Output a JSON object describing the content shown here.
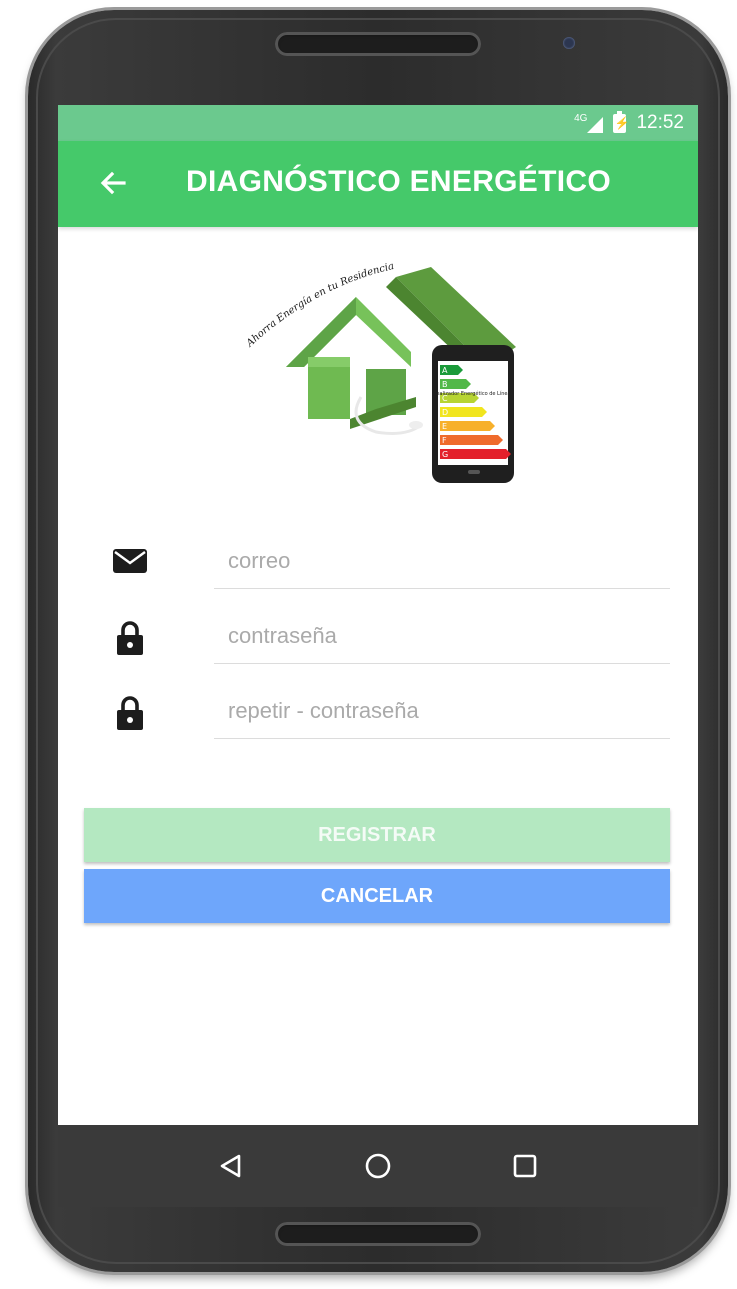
{
  "status_bar": {
    "network_label": "4G",
    "time": "12:52"
  },
  "app_bar": {
    "title": "DIAGNÓSTICO ENERGÉTICO"
  },
  "logo": {
    "arc_text": "Ahorra Energía en tu Residencia",
    "rating_letters": [
      "A",
      "B",
      "C",
      "D",
      "E",
      "F",
      "G"
    ],
    "rating_colors": [
      "#1b9b3a",
      "#52b848",
      "#b7d433",
      "#f1e51e",
      "#f7b02b",
      "#ef6b2c",
      "#e3202b"
    ],
    "phone_caption": "Analizador Energético de Líneas"
  },
  "form": {
    "email_placeholder": "correo",
    "password_placeholder": "contraseña",
    "repeat_password_placeholder": "repetir - contraseña"
  },
  "buttons": {
    "register_label": "REGISTRAR",
    "cancel_label": "CANCELAR"
  },
  "colors": {
    "status_bar": "#6bc98e",
    "app_bar": "#45c96a",
    "register_button_disabled": "#b4e8c1",
    "cancel_button": "#6ea6fb",
    "nav_bar": "#3a3a3a"
  }
}
